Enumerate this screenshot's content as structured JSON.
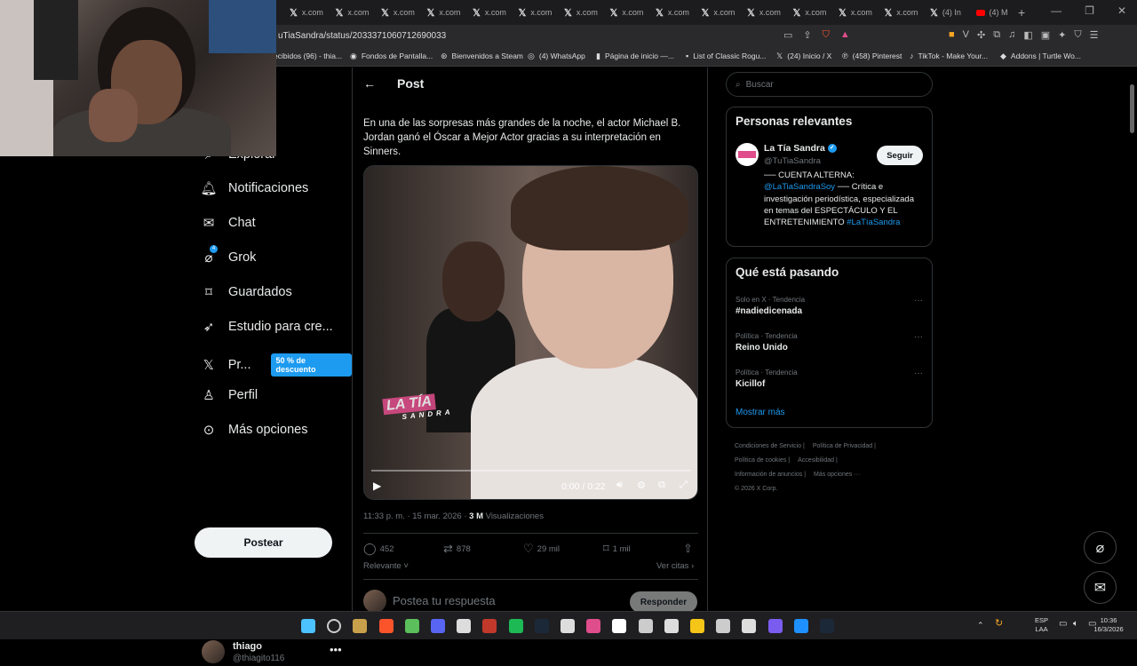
{
  "browser": {
    "tabs": [
      {
        "label": "x.com",
        "icon": "x-icon"
      },
      {
        "label": "x.com",
        "icon": "x-icon"
      },
      {
        "label": "x.com",
        "icon": "x-icon"
      },
      {
        "label": "x.com",
        "icon": "x-icon"
      },
      {
        "label": "x.com",
        "icon": "x-icon"
      },
      {
        "label": "x.com",
        "icon": "x-icon"
      },
      {
        "label": "x.com",
        "icon": "x-icon"
      },
      {
        "label": "x.com",
        "icon": "x-icon"
      },
      {
        "label": "x.com",
        "icon": "x-icon"
      },
      {
        "label": "x.com",
        "icon": "x-icon"
      },
      {
        "label": "x.com",
        "icon": "x-icon"
      },
      {
        "label": "x.com",
        "icon": "x-icon"
      },
      {
        "label": "x.com",
        "icon": "x-icon"
      },
      {
        "label": "x.com",
        "icon": "x-icon"
      },
      {
        "label": "(4) In",
        "icon": "x-icon"
      },
      {
        "label": "(4) M",
        "icon": "youtube-icon"
      }
    ],
    "url": "uTiaSandra/status/2033371060712690033",
    "bookmarks": [
      {
        "label": "ecibidos (96) - thia...",
        "icon": "mail-icon"
      },
      {
        "label": "Fondos de Pantalla...",
        "icon": "image-icon"
      },
      {
        "label": "Bienvenidos a Steam",
        "icon": "steam-icon"
      },
      {
        "label": "(4) WhatsApp",
        "icon": "whatsapp-icon"
      },
      {
        "label": "Página de inicio —...",
        "icon": "page-icon"
      },
      {
        "label": "List of Classic Rogu...",
        "icon": "list-icon"
      },
      {
        "label": "(24) Inicio / X",
        "icon": "x-icon"
      },
      {
        "label": "(458) Pinterest",
        "icon": "pinterest-icon"
      },
      {
        "label": "TikTok - Make Your...",
        "icon": "tiktok-icon"
      },
      {
        "label": "Addons | Turtle Wo...",
        "icon": "addon-icon"
      }
    ]
  },
  "sidebar": {
    "partial_item": "Explorar",
    "notification_badge": "4",
    "items": [
      {
        "label": "Notificaciones",
        "icon": "bell-icon"
      },
      {
        "label": "Chat",
        "icon": "mail-icon"
      },
      {
        "label": "Grok",
        "icon": "grok-icon"
      },
      {
        "label": "Guardados",
        "icon": "bookmark-icon"
      },
      {
        "label": "Estudio para cre...",
        "icon": "rocket-icon"
      },
      {
        "label": "Pr...",
        "icon": "x-logo-icon"
      },
      {
        "label": "Perfil",
        "icon": "person-icon"
      },
      {
        "label": "Más opciones",
        "icon": "more-circle-icon"
      }
    ],
    "premium_badge": "50 % de descuento",
    "post_button": "Postear",
    "account": {
      "name": "thiago",
      "handle": "@thiagito116"
    }
  },
  "post": {
    "header": "Post",
    "text": "En una de las sorpresas más grandes de la noche, el actor Michael B. Jordan ganó el Óscar a Mejor Actor  gracias a su interpretación en Sinners.",
    "video": {
      "watermark_main": "LA TÍA",
      "watermark_sub": "SANDRA",
      "time": "0:00 / 0:22",
      "progress": 0
    },
    "time": "11:33 p. m. · 15 mar. 2026 · ",
    "views_count": "3 M",
    "views_label": " Visualizaciones",
    "stats": {
      "replies": "452",
      "reposts": "878",
      "likes": "29 mil",
      "bookmarks": "1 mil"
    },
    "sort": "Relevante",
    "quotes": "Ver citas",
    "reply_placeholder": "Postea tu respuesta",
    "reply_button": "Responder"
  },
  "right": {
    "search_placeholder": "Buscar",
    "relevant_title": "Personas relevantes",
    "person": {
      "name": "La Tía Sandra",
      "handle": "@TuTiaSandra",
      "follow": "Seguir",
      "bio_a": "── CUENTA ALTERNA: ",
      "bio_link1": "@LaTiaSandraSoy",
      "bio_b": " ── Crítica e investigación periodística, especializada en temas del ESPECTÁCULO Y EL ENTRETENIMIENTO ",
      "bio_link2": "#LaTíaSandra"
    },
    "trends_title": "Qué está pasando",
    "trends": [
      {
        "category": "Solo en X · Tendencia",
        "title": "#nadiedicenada"
      },
      {
        "category": "Política · Tendencia",
        "title": "Reino Unido"
      },
      {
        "category": "Política · Tendencia",
        "title": "Kicillof"
      }
    ],
    "show_more": "Mostrar más",
    "footer": [
      "Condiciones de Servicio |",
      "Política de Privacidad |",
      "Política de cookies |",
      "Accesibilidad |",
      "Información de anuncios |",
      "Más opciones ···",
      "© 2026 X Corp."
    ]
  },
  "taskbar": {
    "lang": "ESP",
    "lang2": "LAA",
    "time": "10:36",
    "date": "16/3/2026"
  },
  "colors": {
    "accent": "#1d9bf0",
    "background": "#000000",
    "border": "#2f3336"
  }
}
